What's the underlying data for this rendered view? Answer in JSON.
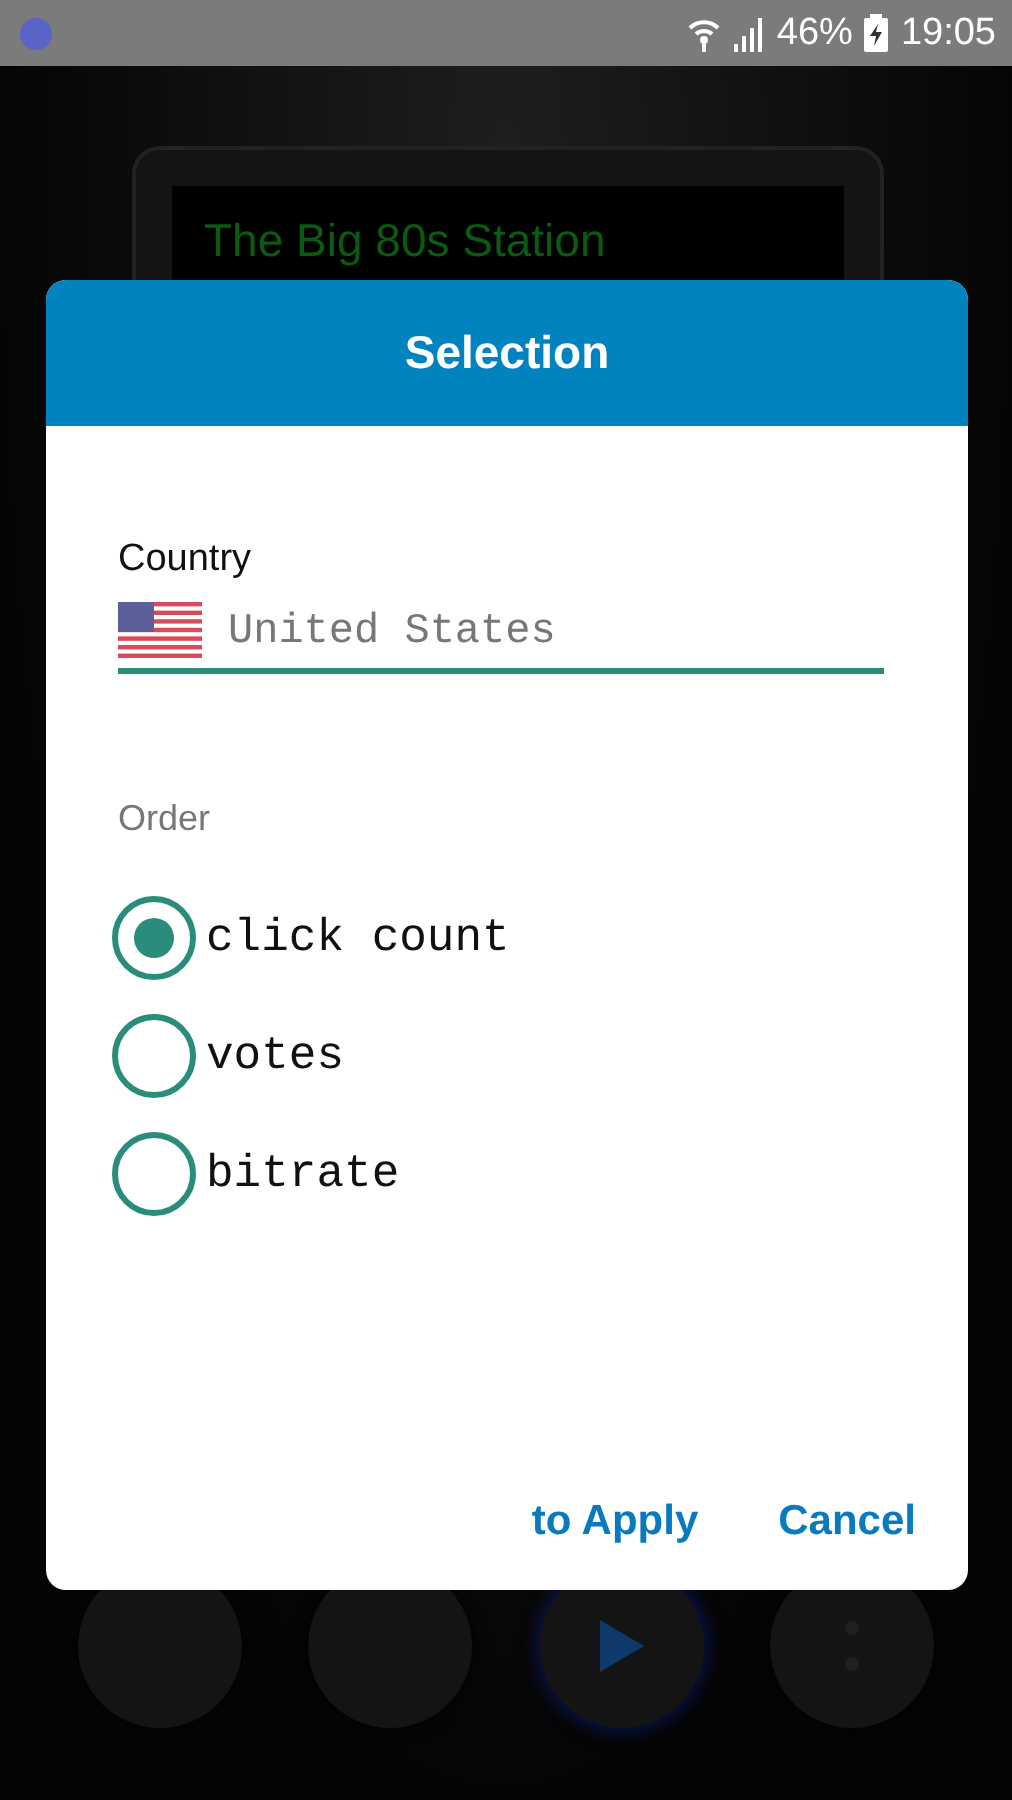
{
  "status_bar": {
    "battery": "46%",
    "time": "19:05"
  },
  "player": {
    "station": "The Big 80s Station"
  },
  "dialog": {
    "title": "Selection",
    "country_label": "Country",
    "country": "United States",
    "order_label": "Order",
    "options": [
      {
        "label": "click count",
        "selected": true
      },
      {
        "label": "votes",
        "selected": false
      },
      {
        "label": "bitrate",
        "selected": false
      }
    ],
    "buttons": [
      "to Apply",
      "Cancel"
    ]
  }
}
